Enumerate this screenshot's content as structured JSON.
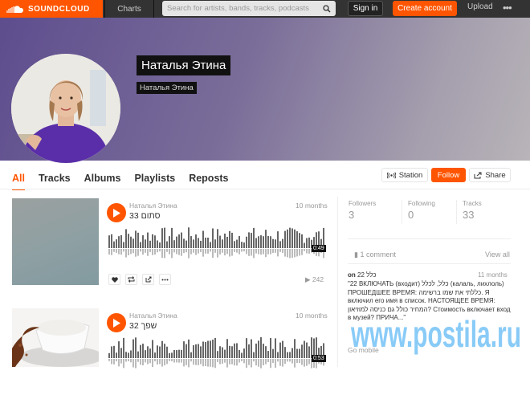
{
  "header": {
    "logo_text": "SOUNDCLOUD",
    "charts": "Charts",
    "search_placeholder": "Search for artists, bands, tracks, podcasts",
    "signin": "Sign in",
    "create": "Create account",
    "upload": "Upload",
    "more": "•••"
  },
  "profile": {
    "username": "Наталья Этина",
    "realname": "Наталья Этина"
  },
  "tabs": [
    "All",
    "Tracks",
    "Albums",
    "Playlists",
    "Reposts"
  ],
  "buttons": {
    "station": "Station",
    "follow": "Follow",
    "share": "Share"
  },
  "tracks": [
    {
      "user": "Наталья Этина",
      "title": "33 סתום",
      "date": "10 months",
      "duration": "0:49",
      "plays": "242"
    },
    {
      "user": "Наталья Этина",
      "title": "32 שפך",
      "date": "10 months",
      "duration": "0:53"
    }
  ],
  "stats": {
    "followers_label": "Followers",
    "followers": "3",
    "following_label": "Following",
    "following": "0",
    "tracks_label": "Tracks",
    "tracks": "33"
  },
  "comments": {
    "count": "1 comment",
    "view_all": "View all",
    "on_prefix": "on",
    "on_track": "22 כלל",
    "date": "11 months",
    "text": "\"22 ВКЛЮЧАТЬ (входит) כלל, לכלל (калаль, лихлоль) ПРОШЕДШЕЕ ВРЕМЯ: כללתי את שמו ברשימה. Я включил его имя в список. НАСТОЯЩЕЕ ВРЕМЯ: המחיר כולל גם כניסה למוזיאון? Стоимость включает вход в музей? ПРИЧА...\""
  },
  "footer": {
    "gomobile": "Go mobile"
  },
  "watermark": "www.postila.ru",
  "colors": {
    "accent": "#ff5500",
    "header": "#333333"
  }
}
